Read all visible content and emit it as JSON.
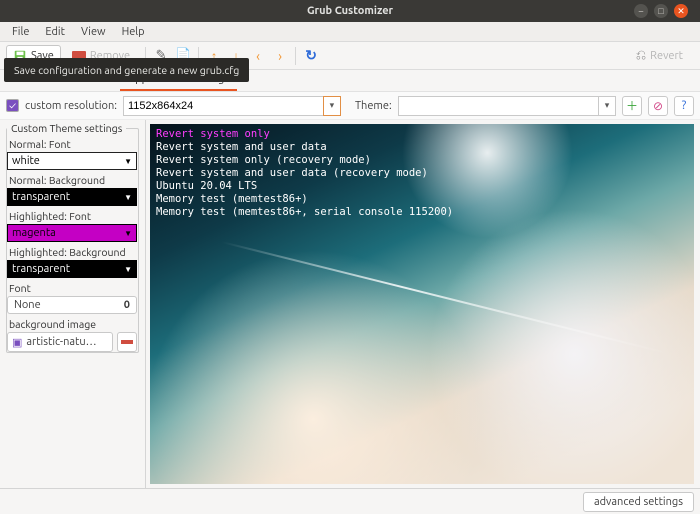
{
  "window": {
    "title": "Grub Customizer"
  },
  "menubar": [
    "File",
    "Edit",
    "View",
    "Help"
  ],
  "toolbar": {
    "save": "Save",
    "remove": "Remove",
    "revert": "Revert",
    "tooltip": "Save configuration and generate a new grub.cfg"
  },
  "tabs": {
    "active": "Appearance settings"
  },
  "resolution": {
    "checkbox_label": "custom resolution:",
    "value": "1152x864x24",
    "theme_label": "Theme:",
    "theme_value": ""
  },
  "theme_settings": {
    "legend": "Custom Theme settings",
    "normal_font_label": "Normal: Font",
    "normal_font_value": "white",
    "normal_bg_label": "Normal: Background",
    "normal_bg_value": "transparent",
    "hi_font_label": "Highlighted: Font",
    "hi_font_value": "magenta",
    "hi_bg_label": "Highlighted: Background",
    "hi_bg_value": "transparent",
    "font_label": "Font",
    "font_value": "None",
    "font_size": "0",
    "bgimage_label": "background image",
    "bgimage_value": "artistic-natu…"
  },
  "preview_menu": {
    "highlighted": "Revert system only",
    "items": [
      "Revert system and user data",
      "Revert system only (recovery mode)",
      "Revert system and user data (recovery mode)",
      "Ubuntu 20.04 LTS",
      "Memory test (memtest86+)",
      "Memory test (memtest86+, serial console 115200)"
    ]
  },
  "footer": {
    "advanced": "advanced settings"
  }
}
